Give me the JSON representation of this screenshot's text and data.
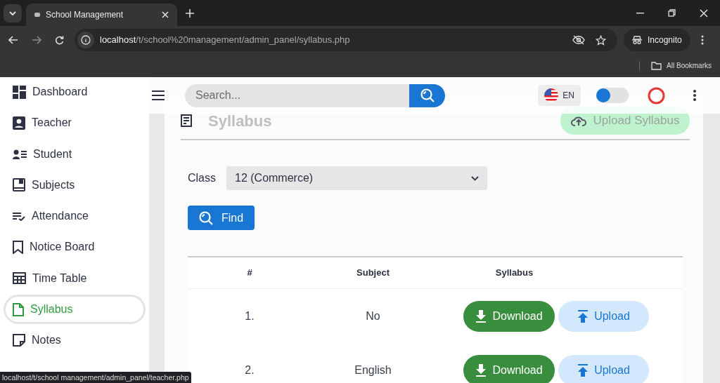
{
  "browser": {
    "tab_title": "School Management",
    "url_host": "localhost",
    "url_path": "/t/school%20management/admin_panel/syllabus.php",
    "profile": "Incognito",
    "bookmarks": "All Bookmarks"
  },
  "sidebar": {
    "items": [
      {
        "label": "Dashboard",
        "kind": "dashboard",
        "selected": false
      },
      {
        "label": "Teacher",
        "kind": "teacher",
        "selected": false
      },
      {
        "label": "Student",
        "kind": "student",
        "selected": false
      },
      {
        "label": "Subjects",
        "kind": "subjects",
        "selected": false
      },
      {
        "label": "Attendance",
        "kind": "attendance",
        "selected": false
      },
      {
        "label": "Notice Board",
        "kind": "notice",
        "selected": false
      },
      {
        "label": "Time Table",
        "kind": "timetable",
        "selected": false
      },
      {
        "label": "Syllabus",
        "kind": "syllabus",
        "selected": true
      },
      {
        "label": "Notes",
        "kind": "notes",
        "selected": false
      }
    ]
  },
  "header": {
    "search_placeholder": "Search...",
    "language": "EN",
    "toggle_on": false
  },
  "page": {
    "title": "Syllabus",
    "upload_button": "Upload Syllabus",
    "class_label": "Class",
    "class_value": "12 (Commerce)",
    "find_button": "Find",
    "table": {
      "columns": [
        "#",
        "Subject",
        "Syllabus"
      ],
      "rows": [
        {
          "index": "1.",
          "subject": "No",
          "download": "Download",
          "upload": "Upload"
        },
        {
          "index": "2.",
          "subject": "English",
          "download": "Download",
          "upload": "Upload"
        }
      ]
    }
  },
  "status_bar": "localhost/t/school management/admin_panel/teacher.php"
}
